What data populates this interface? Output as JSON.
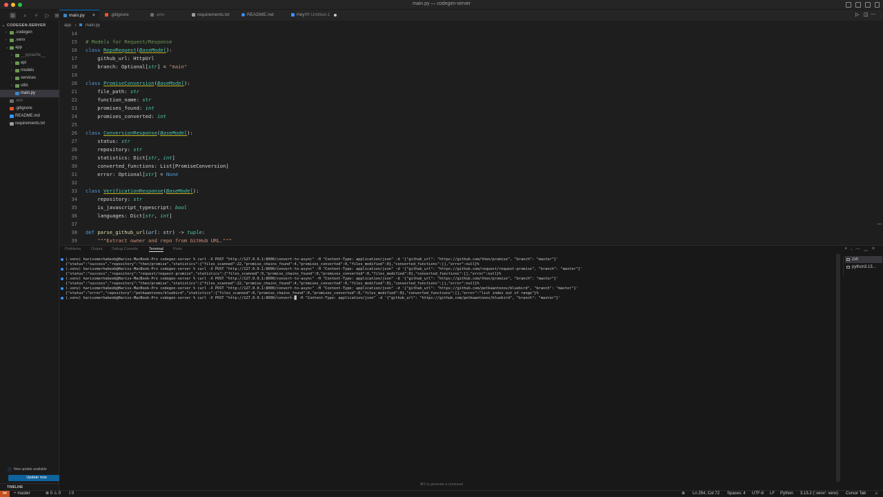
{
  "window": {
    "title": "main.py — codegen-server"
  },
  "tabs": [
    {
      "label": "main.py",
      "icon_color": "#3b86c6",
      "active": true,
      "icon": "python-icon"
    },
    {
      "label": ".gitignore",
      "icon_color": "#e4572e",
      "icon": "git-icon"
    },
    {
      "label": ".env",
      "icon_color": "#6e6e6e",
      "icon": "settings-icon"
    },
    {
      "label": "requirements.txt",
      "icon_color": "#9d9d9d",
      "icon": "text-file-icon"
    },
    {
      "label": "README.md",
      "icon_color": "#3794ff",
      "icon": "info-icon"
    },
    {
      "label": "Hey!!!!",
      "sublabel": "Untitled-1",
      "icon_color": "#3794ff",
      "icon": "text-file-icon"
    }
  ],
  "explorer": {
    "header": "CODEGEN-SERVER",
    "items": [
      {
        "label": ".codegen",
        "depth": 0,
        "type": "folder",
        "chevron": "›",
        "color": "#c5c5c5"
      },
      {
        "label": ".venv",
        "depth": 0,
        "type": "folder",
        "chevron": "›",
        "color": "#c5c5c5"
      },
      {
        "label": "app",
        "depth": 0,
        "type": "folder-open",
        "chevron": "⌄",
        "color": "#c5c5c5"
      },
      {
        "label": "__pycache__",
        "depth": 1,
        "type": "folder",
        "chevron": "›",
        "color": "#7a7a7a"
      },
      {
        "label": "api",
        "depth": 1,
        "type": "folder",
        "chevron": "›",
        "color": "#c5c5c5"
      },
      {
        "label": "models",
        "depth": 1,
        "type": "folder",
        "chevron": "›",
        "color": "#c5c5c5"
      },
      {
        "label": "services",
        "depth": 1,
        "type": "folder",
        "chevron": "›",
        "color": "#c5c5c5"
      },
      {
        "label": "utils",
        "depth": 1,
        "type": "folder",
        "chevron": "›",
        "color": "#c5c5c5"
      },
      {
        "label": "main.py",
        "depth": 1,
        "type": "python",
        "chevron": "",
        "color": "#e0e0e0",
        "selected": true
      },
      {
        "label": ".env",
        "depth": 0,
        "type": "env",
        "chevron": "",
        "color": "#7a7a7a"
      },
      {
        "label": ".gitignore",
        "depth": 0,
        "type": "git",
        "chevron": "",
        "color": "#c5c5c5"
      },
      {
        "label": "README.md",
        "depth": 0,
        "type": "md",
        "chevron": "",
        "color": "#c5c5c5"
      },
      {
        "label": "requirements.txt",
        "depth": 0,
        "type": "txt",
        "chevron": "",
        "color": "#c5c5c5"
      }
    ],
    "update_notice": "New update available",
    "update_button": "Update now",
    "timeline": "TIMELINE"
  },
  "breadcrumb": {
    "parts": [
      "app",
      "main.py"
    ],
    "separator": "›"
  },
  "editor": {
    "lines": [
      {
        "n": "14",
        "t": []
      },
      {
        "n": "15",
        "t": [
          [
            "cmt",
            "# Models for Request/Response"
          ]
        ]
      },
      {
        "n": "16",
        "t": [
          [
            "kw",
            "class "
          ],
          [
            "cls",
            "RepoRequest"
          ],
          [
            "opc",
            "("
          ],
          [
            "base",
            "BaseModel"
          ],
          [
            "opc",
            "):"
          ]
        ]
      },
      {
        "n": "17",
        "t": [
          [
            "varc",
            "    github_url: HttpUrl"
          ]
        ]
      },
      {
        "n": "18",
        "t": [
          [
            "varc",
            "    branch: Optional["
          ],
          [
            "typ",
            "str"
          ],
          [
            "varc",
            "] = "
          ],
          [
            "str",
            "\"main\""
          ]
        ]
      },
      {
        "n": "19",
        "t": []
      },
      {
        "n": "20",
        "t": [
          [
            "kw",
            "class "
          ],
          [
            "cls",
            "PromiseConversion"
          ],
          [
            "opc",
            "("
          ],
          [
            "base",
            "BaseModel"
          ],
          [
            "opc",
            "):"
          ]
        ]
      },
      {
        "n": "21",
        "t": [
          [
            "varc",
            "    file_path: "
          ],
          [
            "typ",
            "str"
          ]
        ]
      },
      {
        "n": "22",
        "t": [
          [
            "varc",
            "    function_name: "
          ],
          [
            "typ",
            "str"
          ]
        ]
      },
      {
        "n": "23",
        "t": [
          [
            "varc",
            "    promises_found: "
          ],
          [
            "typ",
            "int"
          ]
        ]
      },
      {
        "n": "24",
        "t": [
          [
            "varc",
            "    promises_converted: "
          ],
          [
            "typ",
            "int"
          ]
        ]
      },
      {
        "n": "25",
        "t": []
      },
      {
        "n": "26",
        "t": [
          [
            "kw",
            "class "
          ],
          [
            "cls",
            "ConversionResponse"
          ],
          [
            "opc",
            "("
          ],
          [
            "base",
            "BaseModel"
          ],
          [
            "opc",
            "):"
          ]
        ]
      },
      {
        "n": "27",
        "t": [
          [
            "varc",
            "    status: "
          ],
          [
            "typ",
            "str"
          ]
        ]
      },
      {
        "n": "28",
        "t": [
          [
            "varc",
            "    repository: "
          ],
          [
            "typ",
            "str"
          ]
        ]
      },
      {
        "n": "29",
        "t": [
          [
            "varc",
            "    statistics: Dict["
          ],
          [
            "typ",
            "str"
          ],
          [
            "varc",
            ", "
          ],
          [
            "typ",
            "int"
          ],
          [
            "varc",
            "]"
          ]
        ]
      },
      {
        "n": "30",
        "t": [
          [
            "varc",
            "    converted_functions: List[PromiseConversion]"
          ]
        ]
      },
      {
        "n": "31",
        "t": [
          [
            "varc",
            "    error: Optional["
          ],
          [
            "typ",
            "str"
          ],
          [
            "varc",
            "] = "
          ],
          [
            "nonec",
            "None"
          ]
        ]
      },
      {
        "n": "32",
        "t": []
      },
      {
        "n": "33",
        "t": [
          [
            "kw",
            "class "
          ],
          [
            "cls",
            "VerificationResponse"
          ],
          [
            "opc",
            "("
          ],
          [
            "base",
            "BaseModel"
          ],
          [
            "opc",
            "):"
          ]
        ]
      },
      {
        "n": "34",
        "t": [
          [
            "varc",
            "    repository: "
          ],
          [
            "typ",
            "str"
          ]
        ]
      },
      {
        "n": "35",
        "t": [
          [
            "varc",
            "    is_javascript_typescript: "
          ],
          [
            "typ",
            "bool"
          ]
        ]
      },
      {
        "n": "36",
        "t": [
          [
            "varc",
            "    languages: Dict["
          ],
          [
            "typ",
            "str"
          ],
          [
            "varc",
            ", "
          ],
          [
            "typ",
            "int"
          ],
          [
            "varc",
            "]"
          ]
        ]
      },
      {
        "n": "37",
        "t": []
      },
      {
        "n": "38",
        "t": [
          [
            "kw",
            "def "
          ],
          [
            "fn",
            "parse_github_url"
          ],
          [
            "opc",
            "("
          ],
          [
            "prm",
            "url"
          ],
          [
            "varc",
            ": str) -> "
          ],
          [
            "typ",
            "tuple"
          ],
          [
            "opc",
            ":"
          ]
        ]
      },
      {
        "n": "39",
        "t": [
          [
            "str",
            "    \"\"\"Extract owner and repo from GitHub URL.\"\"\""
          ]
        ]
      }
    ]
  },
  "panel": {
    "tabs": [
      "Problems",
      "Output",
      "Debug Console",
      "Terminal",
      "Ports"
    ],
    "active_tab": "Terminal",
    "terminal_lines": [
      {
        "dot": true,
        "text": "(.venv) harisomerhabeeb@Hariss-MacBook-Pro codegen-server % curl -X POST \"http://127.0.0.1:8000/convert-to-async\" -H \"Content-Type: application/json\" -d '{\"github_url\": \"https://github.com/then/promise\", \"branch\": \"master\"}'"
      },
      {
        "dot": false,
        "text": "{\"status\":\"success\",\"repository\":\"then/promise\",\"statistics\":{\"files_scanned\":22,\"promise_chains_found\":4,\"promises_converted\":0,\"files_modified\":0},\"converted_functions\":[],\"error\":null}%"
      },
      {
        "dot": true,
        "text": "(.venv) harisomerhabeeb@Hariss-MacBook-Pro codegen-server % curl -X POST \"http://127.0.0.1:8000/convert-to-async\" -H \"Content-Type: application/json\" -d '{\"github_url\": \"https://github.com/request/request-promise\", \"branch\": \"master\"}'"
      },
      {
        "dot": false,
        "text": "{\"status\":\"success\",\"repository\":\"request/request-promise\",\"statistics\":{\"files_scanned\":9,\"promise_chains_found\":0,\"promises_converted\":0,\"files_modified\":0},\"converted_functions\":[],\"error\":null}%"
      },
      {
        "dot": true,
        "text": "(.venv) harisomerhabeeb@Hariss-MacBook-Pro codegen-server % curl -X POST \"http://127.0.0.1:8000/convert-to-async\" -H \"Content-Type: application/json\" -d '{\"github_url\": \"https://github.com/then/promise\", \"branch\": \"master\"}'"
      },
      {
        "dot": false,
        "text": "{\"status\":\"success\",\"repository\":\"then/promise\",\"statistics\":{\"files_scanned\":22,\"promise_chains_found\":4,\"promises_converted\":0,\"files_modified\":0},\"converted_functions\":[],\"error\":null}%"
      },
      {
        "dot": true,
        "text": "(.venv) harisomerhabeeb@Hariss-MacBook-Pro codegen-server % curl -X POST \"http://127.0.0.1:8000/convert-to-async\" -H \"Content-Type: application/json\" -d '{\"github_url\": \"https://github.com/petkaantonov/bluebird\", \"branch\": \"master\"}'"
      },
      {
        "dot": false,
        "text": "{\"status\":\"error\",\"repository\":\"petkaantonov/bluebird\",\"statistics\":{\"files_scanned\":0,\"promise_chains_found\":0,\"promises_converted\":0,\"files_modified\":0},\"converted_functions\":[],\"error\":\"list index out of range\"}%"
      },
      {
        "dot": true,
        "text": "(.venv) harisomerhabeeb@Hariss-MacBook-Pro codegen-server % curl -X POST \"http://127.0.0.1:8000/convert-█ -H \"Content-Type: application/json\" -d '{\"github_url\": \"https://github.com/petkaantonov/bluebird\", \"branch\": \"master\"}'"
      }
    ],
    "terminal_list": [
      {
        "label": "zsh",
        "selected": true
      },
      {
        "label": "python3.13...",
        "selected": false
      }
    ],
    "hint": "⌘K to generate a command"
  },
  "statusbar": {
    "branch": "master",
    "problems": "⊗ 0 ⚠ 0",
    "ports": "⟟ 0",
    "position": "Ln 254, Col 72",
    "spaces": "Spaces: 4",
    "encoding": "UTF-8",
    "eol": "LF",
    "language": "Python",
    "interpreter": "3.13.2 ('.venv': venv)",
    "tab_mode": "Cursor Tab"
  },
  "colors": {
    "accent": "#0078d4",
    "remote_bg": "#c5501f",
    "update_button": "#0e639c"
  }
}
